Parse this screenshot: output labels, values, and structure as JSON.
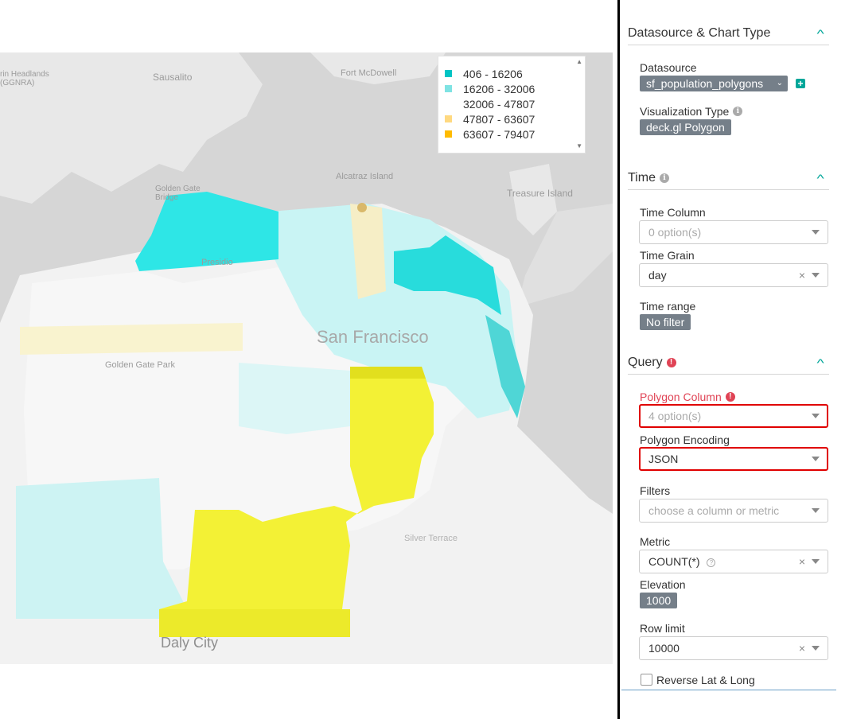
{
  "map": {
    "labels": {
      "headlands": "rin Headlands\n(GGNRA)",
      "sausalito": "Sausalito",
      "fort_mcdowell": "Fort McDowell",
      "alcatraz": "Alcatraz Island",
      "treasure_island": "Treasure Island",
      "golden_gate_bridge": "Golden Gate\nBridge",
      "presidio": "Presidio",
      "san_francisco": "San Francisco",
      "golden_gate_park": "Golden Gate Park",
      "silver_terrace": "Silver Terrace",
      "daly_city": "Daly City"
    }
  },
  "legend": {
    "items": [
      {
        "label": "406 - 16206",
        "color": "#00c4c4"
      },
      {
        "label": "16206 - 32006",
        "color": "#7fe3e3"
      },
      {
        "label": "32006 - 47807",
        "color": "#ffffff"
      },
      {
        "label": "47807 - 63607",
        "color": "#ffd980"
      },
      {
        "label": "63607 - 79407",
        "color": "#ffbb00"
      }
    ]
  },
  "panel": {
    "datasource_section": {
      "title": "Datasource & Chart Type",
      "datasource_label": "Datasource",
      "datasource_value": "sf_population_polygons",
      "viz_type_label": "Visualization Type",
      "viz_type_value": "deck.gl Polygon"
    },
    "time_section": {
      "title": "Time",
      "time_column_label": "Time Column",
      "time_column_placeholder": "0 option(s)",
      "time_grain_label": "Time Grain",
      "time_grain_value": "day",
      "time_range_label": "Time range",
      "time_range_value": "No filter"
    },
    "query_section": {
      "title": "Query",
      "polygon_column_label": "Polygon Column",
      "polygon_column_placeholder": "4 option(s)",
      "polygon_encoding_label": "Polygon Encoding",
      "polygon_encoding_value": "JSON",
      "filters_label": "Filters",
      "filters_placeholder": "choose a column or metric",
      "metric_label": "Metric",
      "metric_value": "COUNT(*)",
      "elevation_label": "Elevation",
      "elevation_value": "1000",
      "row_limit_label": "Row limit",
      "row_limit_value": "10000",
      "reverse_label": "Reverse Lat & Long"
    }
  }
}
